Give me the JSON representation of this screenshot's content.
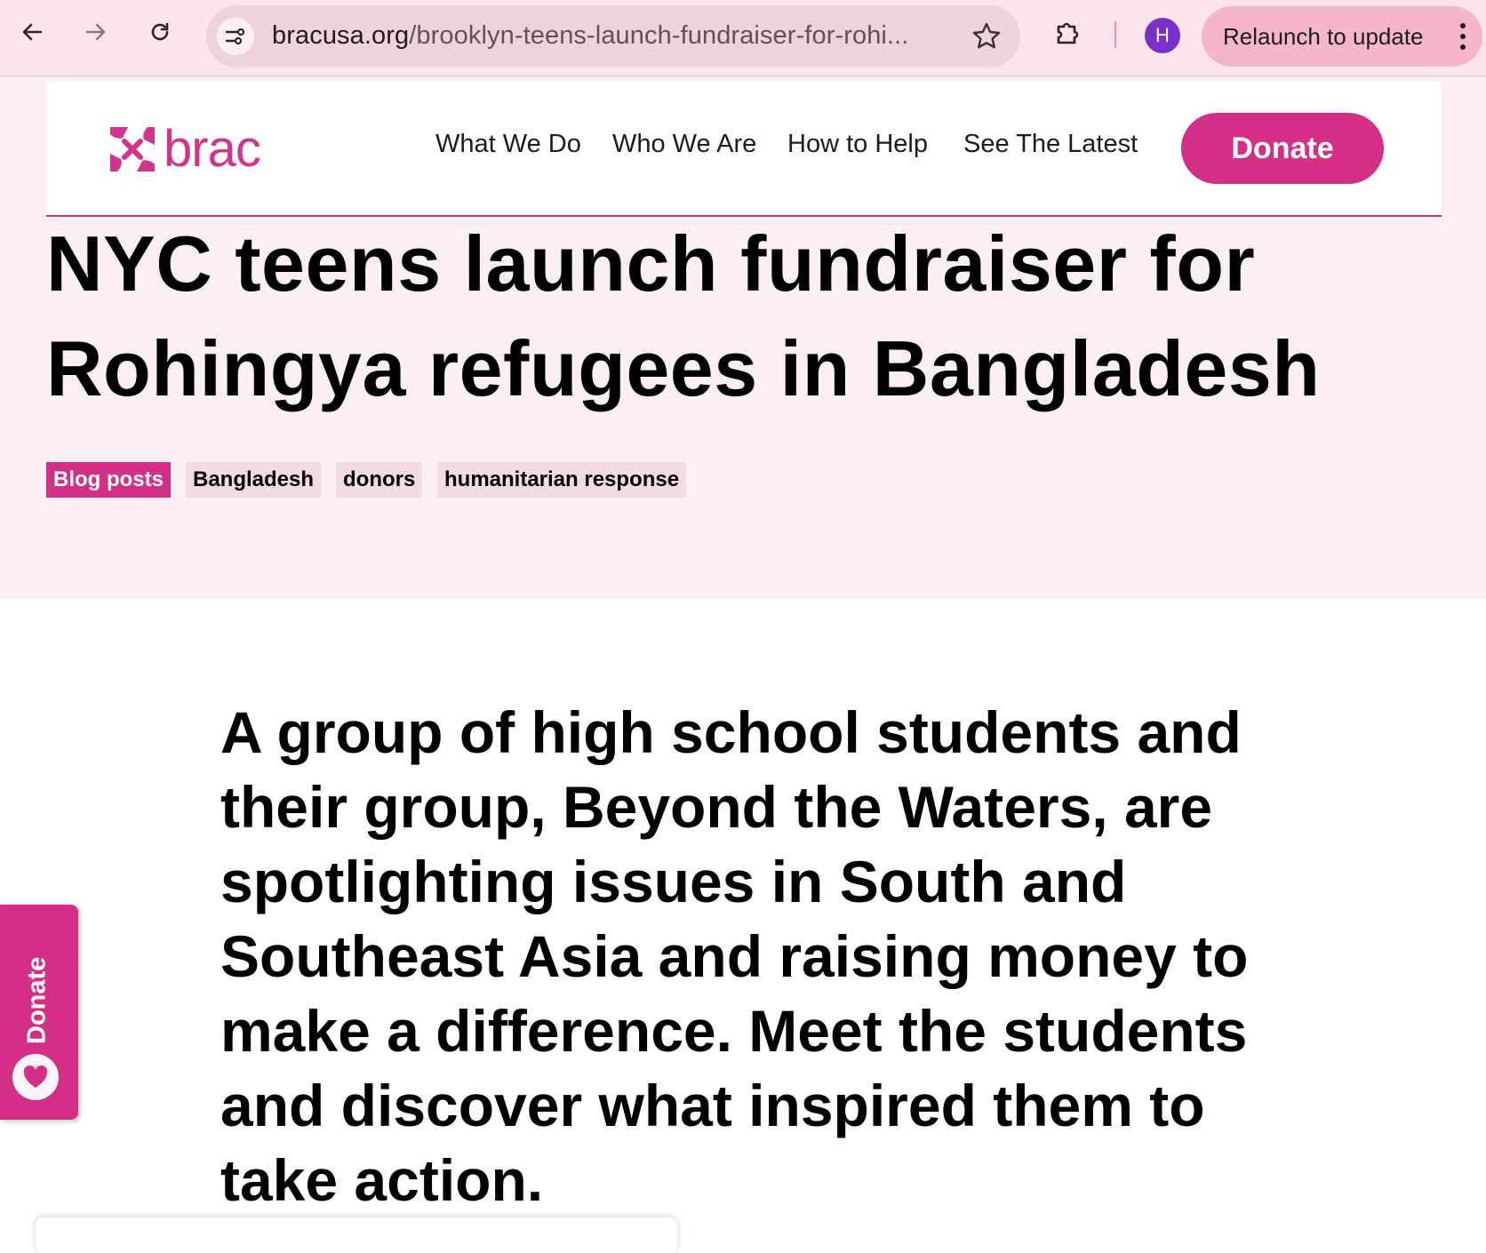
{
  "browser": {
    "url_domain": "bracusa.org",
    "url_path": "/brooklyn-teens-launch-fundraiser-for-rohi...",
    "profile_initial": "H",
    "relaunch_label": "Relaunch to update"
  },
  "site": {
    "logo_text": "brac",
    "nav": [
      "What We Do",
      "Who We Are",
      "How to Help",
      "See The Latest"
    ],
    "donate_label": "Donate",
    "brand_color": "#d32f86"
  },
  "article": {
    "title_line1": "NYC teens launch fundraiser for",
    "title_line2": "Rohingya refugees in Bangladesh",
    "tags": [
      "Blog posts",
      "Bangladesh",
      "donors",
      "humanitarian response"
    ],
    "intro": "A group of high school students and their group, Beyond the Waters, are spotlighting issues in South and Southeast Asia and raising money to make a difference. Meet the students and discover what inspired them to take action."
  },
  "floating": {
    "donate_label": "Donate"
  }
}
